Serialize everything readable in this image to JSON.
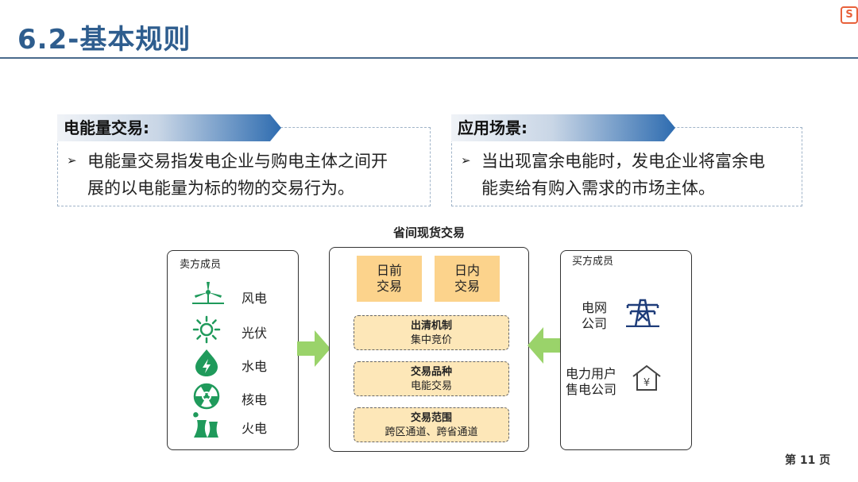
{
  "header": {
    "title": "6.2-基本规则"
  },
  "left_box": {
    "heading": "电能量交易:",
    "line1": "电能量交易指发电企业与购电主体之间开",
    "line2": "展的以电能量为标的物的交易行为。"
  },
  "right_box": {
    "heading": "应用场景:",
    "line1": "当出现富余电能时，发电企业将富余电",
    "line2": "能卖给有购入需求的市场主体。"
  },
  "bullet_glyph": "➢",
  "diagram": {
    "title": "省间现货交易",
    "sellers": {
      "label": "卖方成员",
      "items": [
        {
          "label": "风电",
          "icon": "wind-turbine-icon"
        },
        {
          "label": "光伏",
          "icon": "sun-icon"
        },
        {
          "label": "水电",
          "icon": "water-drop-icon"
        },
        {
          "label": "核电",
          "icon": "nuclear-icon"
        },
        {
          "label": "火电",
          "icon": "cooling-tower-icon"
        }
      ]
    },
    "center": {
      "tile1_line1": "日前",
      "tile1_line2": "交易",
      "tile2_line1": "日内",
      "tile2_line2": "交易",
      "pill1_title": "出清机制",
      "pill1_sub": "集中竞价",
      "pill2_title": "交易品种",
      "pill2_sub": "电能交易",
      "pill3_title": "交易范围",
      "pill3_sub": "跨区通道、跨省通道"
    },
    "buyers": {
      "label": "买方成员",
      "grid_line1": "电网",
      "grid_line2": "公司",
      "user_line1": "电力用户",
      "user_line2": "售电公司",
      "yen": "¥"
    }
  },
  "logo_glyph": "S",
  "page_number": "第 11 页",
  "colors": {
    "title": "#2e5d8e",
    "green": "#1f9a5b",
    "arrow": "#9ad36a",
    "tile": "#fcd38c",
    "pill": "#fde7b8",
    "navy": "#1f3d7a"
  }
}
